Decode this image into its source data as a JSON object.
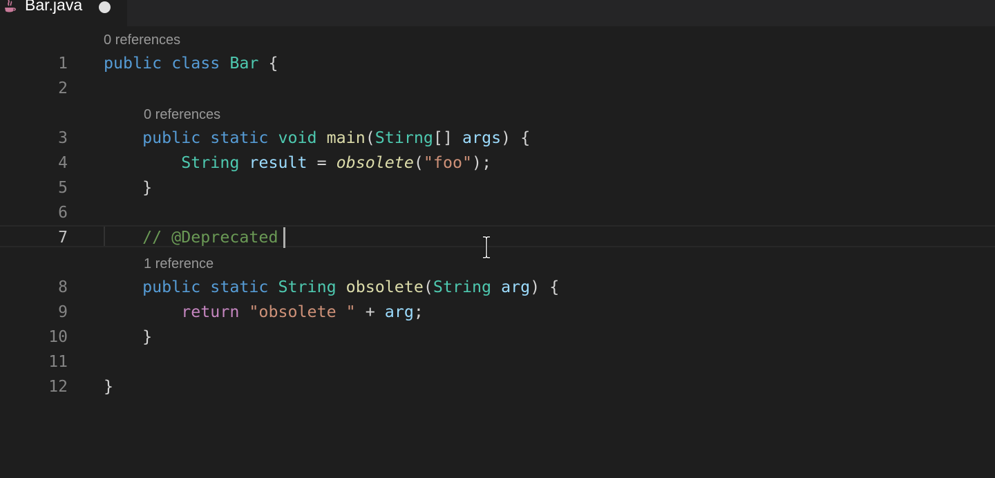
{
  "tab": {
    "icon": "java-icon",
    "title": "Bar.java",
    "dirty": true
  },
  "codelens": {
    "class_refs": "0 references",
    "main_refs": "0 references",
    "obsolete_refs": "1 reference"
  },
  "line_numbers": [
    "1",
    "2",
    "3",
    "4",
    "5",
    "6",
    "7",
    "8",
    "9",
    "10",
    "11",
    "12"
  ],
  "active_line": "7",
  "code": {
    "l1": {
      "kw1": "public",
      "kw2": "class",
      "name": "Bar",
      "brace": "{"
    },
    "l3": {
      "kw1": "public",
      "kw2": "static",
      "kw3": "void",
      "fn": "main",
      "open": "(",
      "type": "Stirng",
      "arr": "[]",
      "param": "args",
      "close": ")",
      "brace": "{"
    },
    "l4": {
      "type": "String",
      "var": "result",
      "eq": "=",
      "fn": "obsolete",
      "open": "(",
      "str": "\"foo\"",
      "close": ");"
    },
    "l5": {
      "brace": "}"
    },
    "l7": {
      "comment": "// @Deprecated"
    },
    "l8": {
      "kw1": "public",
      "kw2": "static",
      "type": "String",
      "fn": "obsolete",
      "open": "(",
      "ptype": "String",
      "param": "arg",
      "close": ")",
      "brace": "{"
    },
    "l9": {
      "kw": "return",
      "str": "\"obsolete \"",
      "op": "+",
      "var": "arg",
      "semi": ";"
    },
    "l10": {
      "brace": "}"
    },
    "l12": {
      "brace": "}"
    }
  },
  "colors": {
    "background": "#1e1e1e",
    "keyword": "#569cd6",
    "type": "#4ec9b0",
    "function": "#dcdcaa",
    "parameter": "#9cdcfe",
    "string": "#ce9178",
    "comment": "#6a9955",
    "control": "#c586c0"
  }
}
